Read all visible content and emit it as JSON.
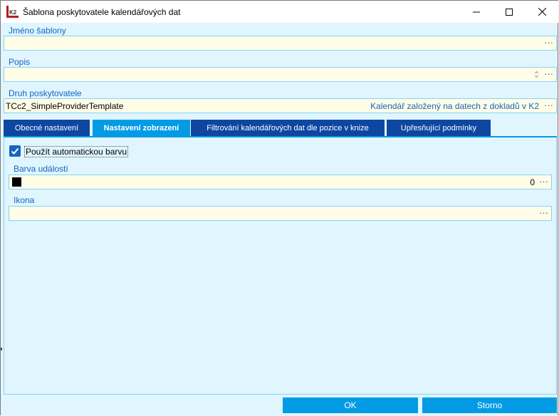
{
  "window": {
    "title": "Šablona poskytovatele kalendářových dat",
    "icon": "k2-app-icon",
    "controls": [
      "minimize-icon",
      "maximize-icon",
      "close-icon"
    ]
  },
  "fields": {
    "template_name": {
      "label": "Jméno šablony",
      "value": ""
    },
    "description": {
      "label": "Popis",
      "value": ""
    },
    "provider_type": {
      "label": "Druh poskytovatele",
      "value": "TCc2_SimpleProviderTemplate",
      "description": "Kalendář založený na datech z dokladů v K2"
    }
  },
  "ellipsis": "···",
  "tabs": [
    {
      "label": "Obecné nastavení",
      "active": false
    },
    {
      "label": "Nastavení zobrazení",
      "active": true
    },
    {
      "label": "Filtrování kalendářových dat dle pozice v knize",
      "active": false
    },
    {
      "label": "Upřesňující podmínky",
      "active": false
    }
  ],
  "display": {
    "auto_color": {
      "label": "Použít automatickou barvu",
      "checked": true
    },
    "event_color": {
      "label": "Barva událostí",
      "value": "0",
      "swatch": "#000000"
    },
    "icon": {
      "label": "Ikona",
      "value": ""
    }
  },
  "buttons": {
    "ok": "OK",
    "cancel": "Storno"
  },
  "colors": {
    "background": "#e1f5fe",
    "field": "#fffde7",
    "tab": "#0d47a1",
    "tab_active": "#039be5",
    "label": "#1565c0"
  }
}
